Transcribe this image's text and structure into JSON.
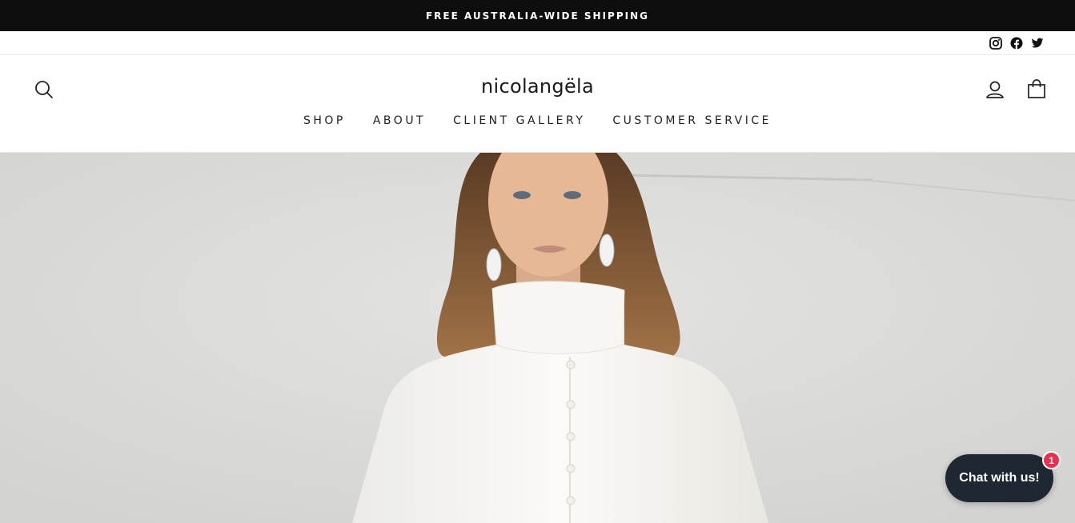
{
  "announcement": {
    "text": "FREE AUSTRALIA-WIDE SHIPPING"
  },
  "social": {
    "icons": [
      "instagram-icon",
      "facebook-icon",
      "twitter-icon"
    ]
  },
  "header": {
    "logo": "nicolangëla",
    "icons": {
      "search": "search-icon",
      "account": "user-icon",
      "cart": "shopping-bag-icon"
    }
  },
  "nav": {
    "items": [
      {
        "label": "SHOP"
      },
      {
        "label": "ABOUT"
      },
      {
        "label": "CLIENT GALLERY"
      },
      {
        "label": "CUSTOMER SERVICE"
      }
    ]
  },
  "chat": {
    "label": "Chat with us!",
    "badge_count": "1"
  },
  "colors": {
    "announcement_bg": "#0e0e0e",
    "chat_bg": "#1f2732",
    "badge": "#e3344f",
    "wall": "#dcdcda"
  }
}
